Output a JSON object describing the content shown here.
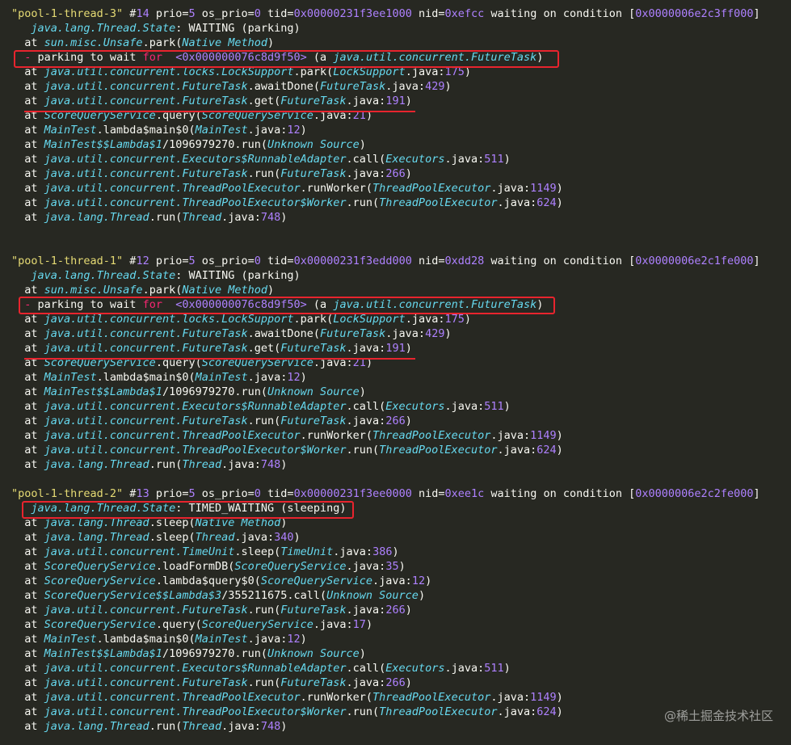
{
  "colors": {
    "background": "#272822",
    "string": "#e6db74",
    "number": "#ae81ff",
    "class": "#66d9ef",
    "plain": "#f8f8f2",
    "keyword": "#f92672",
    "highlight_box": "#e8242e"
  },
  "lines": [
    [
      [
        "s",
        "\"pool-1-thread-3\""
      ],
      [
        "p",
        " #"
      ],
      [
        "n",
        "14"
      ],
      [
        "p",
        " prio="
      ],
      [
        "n",
        "5"
      ],
      [
        "p",
        " os_prio="
      ],
      [
        "n",
        "0"
      ],
      [
        "p",
        " tid="
      ],
      [
        "n",
        "0x00000231f3ee1000"
      ],
      [
        "p",
        " nid="
      ],
      [
        "n",
        "0xefcc"
      ],
      [
        "p",
        " waiting on condition ["
      ],
      [
        "n",
        "0x0000006e2c3ff000"
      ],
      [
        "p",
        "]"
      ]
    ],
    [
      [
        "p",
        "   "
      ],
      [
        "c",
        "java.lang.Thread.State"
      ],
      [
        "p",
        ": WAITING (parking)"
      ]
    ],
    [
      [
        "p",
        "  at "
      ],
      [
        "c",
        "sun.misc.Unsafe"
      ],
      [
        "p",
        ".park("
      ],
      [
        "c",
        "Native Method"
      ],
      [
        "p",
        ")"
      ]
    ],
    [
      [
        "p",
        "  "
      ],
      [
        "k",
        "- "
      ],
      [
        "p",
        "parking to wait "
      ],
      [
        "k",
        "for"
      ],
      [
        "p",
        "  "
      ],
      [
        "n",
        "<0x000000076c8d9f50>"
      ],
      [
        "p",
        " (a "
      ],
      [
        "c",
        "java.util.concurrent.FutureTask"
      ],
      [
        "p",
        ")"
      ]
    ],
    [
      [
        "p",
        "  at "
      ],
      [
        "c",
        "java.util.concurrent.locks.LockSupport"
      ],
      [
        "p",
        ".park("
      ],
      [
        "c",
        "LockSupport"
      ],
      [
        "p",
        ".java:"
      ],
      [
        "n",
        "175"
      ],
      [
        "p",
        ")"
      ]
    ],
    [
      [
        "p",
        "  at "
      ],
      [
        "c",
        "java.util.concurrent.FutureTask"
      ],
      [
        "p",
        ".awaitDone("
      ],
      [
        "c",
        "FutureTask"
      ],
      [
        "p",
        ".java:"
      ],
      [
        "n",
        "429"
      ],
      [
        "p",
        ")"
      ]
    ],
    [
      [
        "p",
        "  at "
      ],
      [
        "c",
        "java.util.concurrent.FutureTask"
      ],
      [
        "p",
        ".get("
      ],
      [
        "c",
        "FutureTask"
      ],
      [
        "p",
        ".java:"
      ],
      [
        "n",
        "191"
      ],
      [
        "p",
        ")"
      ]
    ],
    [
      [
        "p",
        "  at "
      ],
      [
        "c",
        "ScoreQueryService"
      ],
      [
        "p",
        ".query("
      ],
      [
        "c",
        "ScoreQueryService"
      ],
      [
        "p",
        ".java:"
      ],
      [
        "n",
        "21"
      ],
      [
        "p",
        ")"
      ]
    ],
    [
      [
        "p",
        "  at "
      ],
      [
        "c",
        "MainTest"
      ],
      [
        "p",
        ".lambda$main$0("
      ],
      [
        "c",
        "MainTest"
      ],
      [
        "p",
        ".java:"
      ],
      [
        "n",
        "12"
      ],
      [
        "p",
        ")"
      ]
    ],
    [
      [
        "p",
        "  at "
      ],
      [
        "c",
        "MainTest$$Lambda$1"
      ],
      [
        "p",
        "/1096979270.run("
      ],
      [
        "c",
        "Unknown Source"
      ],
      [
        "p",
        ")"
      ]
    ],
    [
      [
        "p",
        "  at "
      ],
      [
        "c",
        "java.util.concurrent.Executors$RunnableAdapter"
      ],
      [
        "p",
        ".call("
      ],
      [
        "c",
        "Executors"
      ],
      [
        "p",
        ".java:"
      ],
      [
        "n",
        "511"
      ],
      [
        "p",
        ")"
      ]
    ],
    [
      [
        "p",
        "  at "
      ],
      [
        "c",
        "java.util.concurrent.FutureTask"
      ],
      [
        "p",
        ".run("
      ],
      [
        "c",
        "FutureTask"
      ],
      [
        "p",
        ".java:"
      ],
      [
        "n",
        "266"
      ],
      [
        "p",
        ")"
      ]
    ],
    [
      [
        "p",
        "  at "
      ],
      [
        "c",
        "java.util.concurrent.ThreadPoolExecutor"
      ],
      [
        "p",
        ".runWorker("
      ],
      [
        "c",
        "ThreadPoolExecutor"
      ],
      [
        "p",
        ".java:"
      ],
      [
        "n",
        "1149"
      ],
      [
        "p",
        ")"
      ]
    ],
    [
      [
        "p",
        "  at "
      ],
      [
        "c",
        "java.util.concurrent.ThreadPoolExecutor$Worker"
      ],
      [
        "p",
        ".run("
      ],
      [
        "c",
        "ThreadPoolExecutor"
      ],
      [
        "p",
        ".java:"
      ],
      [
        "n",
        "624"
      ],
      [
        "p",
        ")"
      ]
    ],
    [
      [
        "p",
        "  at "
      ],
      [
        "c",
        "java.lang.Thread"
      ],
      [
        "p",
        ".run("
      ],
      [
        "c",
        "Thread"
      ],
      [
        "p",
        ".java:"
      ],
      [
        "n",
        "748"
      ],
      [
        "p",
        ")"
      ]
    ],
    [],
    [],
    [
      [
        "s",
        "\"pool-1-thread-1\""
      ],
      [
        "p",
        " #"
      ],
      [
        "n",
        "12"
      ],
      [
        "p",
        " prio="
      ],
      [
        "n",
        "5"
      ],
      [
        "p",
        " os_prio="
      ],
      [
        "n",
        "0"
      ],
      [
        "p",
        " tid="
      ],
      [
        "n",
        "0x00000231f3edd000"
      ],
      [
        "p",
        " nid="
      ],
      [
        "n",
        "0xdd28"
      ],
      [
        "p",
        " waiting on condition ["
      ],
      [
        "n",
        "0x0000006e2c1fe000"
      ],
      [
        "p",
        "]"
      ]
    ],
    [
      [
        "p",
        "   "
      ],
      [
        "c",
        "java.lang.Thread.State"
      ],
      [
        "p",
        ": WAITING (parking)"
      ]
    ],
    [
      [
        "p",
        "  at "
      ],
      [
        "c",
        "sun.misc.Unsafe"
      ],
      [
        "p",
        ".park("
      ],
      [
        "c",
        "Native Method"
      ],
      [
        "p",
        ")"
      ]
    ],
    [
      [
        "p",
        "  "
      ],
      [
        "k",
        "- "
      ],
      [
        "p",
        "parking to wait "
      ],
      [
        "k",
        "for"
      ],
      [
        "p",
        "  "
      ],
      [
        "n",
        "<0x000000076c8d9f50>"
      ],
      [
        "p",
        " (a "
      ],
      [
        "c",
        "java.util.concurrent.FutureTask"
      ],
      [
        "p",
        ")"
      ]
    ],
    [
      [
        "p",
        "  at "
      ],
      [
        "c",
        "java.util.concurrent.locks.LockSupport"
      ],
      [
        "p",
        ".park("
      ],
      [
        "c",
        "LockSupport"
      ],
      [
        "p",
        ".java:"
      ],
      [
        "n",
        "175"
      ],
      [
        "p",
        ")"
      ]
    ],
    [
      [
        "p",
        "  at "
      ],
      [
        "c",
        "java.util.concurrent.FutureTask"
      ],
      [
        "p",
        ".awaitDone("
      ],
      [
        "c",
        "FutureTask"
      ],
      [
        "p",
        ".java:"
      ],
      [
        "n",
        "429"
      ],
      [
        "p",
        ")"
      ]
    ],
    [
      [
        "p",
        "  at "
      ],
      [
        "c",
        "java.util.concurrent.FutureTask"
      ],
      [
        "p",
        ".get("
      ],
      [
        "c",
        "FutureTask"
      ],
      [
        "p",
        ".java:"
      ],
      [
        "n",
        "191"
      ],
      [
        "p",
        ")"
      ]
    ],
    [
      [
        "p",
        "  at "
      ],
      [
        "c",
        "ScoreQueryService"
      ],
      [
        "p",
        ".query("
      ],
      [
        "c",
        "ScoreQueryService"
      ],
      [
        "p",
        ".java:"
      ],
      [
        "n",
        "21"
      ],
      [
        "p",
        ")"
      ]
    ],
    [
      [
        "p",
        "  at "
      ],
      [
        "c",
        "MainTest"
      ],
      [
        "p",
        ".lambda$main$0("
      ],
      [
        "c",
        "MainTest"
      ],
      [
        "p",
        ".java:"
      ],
      [
        "n",
        "12"
      ],
      [
        "p",
        ")"
      ]
    ],
    [
      [
        "p",
        "  at "
      ],
      [
        "c",
        "MainTest$$Lambda$1"
      ],
      [
        "p",
        "/1096979270.run("
      ],
      [
        "c",
        "Unknown Source"
      ],
      [
        "p",
        ")"
      ]
    ],
    [
      [
        "p",
        "  at "
      ],
      [
        "c",
        "java.util.concurrent.Executors$RunnableAdapter"
      ],
      [
        "p",
        ".call("
      ],
      [
        "c",
        "Executors"
      ],
      [
        "p",
        ".java:"
      ],
      [
        "n",
        "511"
      ],
      [
        "p",
        ")"
      ]
    ],
    [
      [
        "p",
        "  at "
      ],
      [
        "c",
        "java.util.concurrent.FutureTask"
      ],
      [
        "p",
        ".run("
      ],
      [
        "c",
        "FutureTask"
      ],
      [
        "p",
        ".java:"
      ],
      [
        "n",
        "266"
      ],
      [
        "p",
        ")"
      ]
    ],
    [
      [
        "p",
        "  at "
      ],
      [
        "c",
        "java.util.concurrent.ThreadPoolExecutor"
      ],
      [
        "p",
        ".runWorker("
      ],
      [
        "c",
        "ThreadPoolExecutor"
      ],
      [
        "p",
        ".java:"
      ],
      [
        "n",
        "1149"
      ],
      [
        "p",
        ")"
      ]
    ],
    [
      [
        "p",
        "  at "
      ],
      [
        "c",
        "java.util.concurrent.ThreadPoolExecutor$Worker"
      ],
      [
        "p",
        ".run("
      ],
      [
        "c",
        "ThreadPoolExecutor"
      ],
      [
        "p",
        ".java:"
      ],
      [
        "n",
        "624"
      ],
      [
        "p",
        ")"
      ]
    ],
    [
      [
        "p",
        "  at "
      ],
      [
        "c",
        "java.lang.Thread"
      ],
      [
        "p",
        ".run("
      ],
      [
        "c",
        "Thread"
      ],
      [
        "p",
        ".java:"
      ],
      [
        "n",
        "748"
      ],
      [
        "p",
        ")"
      ]
    ],
    [],
    [
      [
        "s",
        "\"pool-1-thread-2\""
      ],
      [
        "p",
        " #"
      ],
      [
        "n",
        "13"
      ],
      [
        "p",
        " prio="
      ],
      [
        "n",
        "5"
      ],
      [
        "p",
        " os_prio="
      ],
      [
        "n",
        "0"
      ],
      [
        "p",
        " tid="
      ],
      [
        "n",
        "0x00000231f3ee0000"
      ],
      [
        "p",
        " nid="
      ],
      [
        "n",
        "0xee1c"
      ],
      [
        "p",
        " waiting on condition ["
      ],
      [
        "n",
        "0x0000006e2c2fe000"
      ],
      [
        "p",
        "]"
      ]
    ],
    [
      [
        "p",
        "   "
      ],
      [
        "c",
        "java.lang.Thread.State"
      ],
      [
        "p",
        ": TIMED_WAITING (sleeping)"
      ]
    ],
    [
      [
        "p",
        "  at "
      ],
      [
        "c",
        "java.lang.Thread"
      ],
      [
        "p",
        ".sleep("
      ],
      [
        "c",
        "Native Method"
      ],
      [
        "p",
        ")"
      ]
    ],
    [
      [
        "p",
        "  at "
      ],
      [
        "c",
        "java.lang.Thread"
      ],
      [
        "p",
        ".sleep("
      ],
      [
        "c",
        "Thread"
      ],
      [
        "p",
        ".java:"
      ],
      [
        "n",
        "340"
      ],
      [
        "p",
        ")"
      ]
    ],
    [
      [
        "p",
        "  at "
      ],
      [
        "c",
        "java.util.concurrent.TimeUnit"
      ],
      [
        "p",
        ".sleep("
      ],
      [
        "c",
        "TimeUnit"
      ],
      [
        "p",
        ".java:"
      ],
      [
        "n",
        "386"
      ],
      [
        "p",
        ")"
      ]
    ],
    [
      [
        "p",
        "  at "
      ],
      [
        "c",
        "ScoreQueryService"
      ],
      [
        "p",
        ".loadFormDB("
      ],
      [
        "c",
        "ScoreQueryService"
      ],
      [
        "p",
        ".java:"
      ],
      [
        "n",
        "35"
      ],
      [
        "p",
        ")"
      ]
    ],
    [
      [
        "p",
        "  at "
      ],
      [
        "c",
        "ScoreQueryService"
      ],
      [
        "p",
        ".lambda$query$0("
      ],
      [
        "c",
        "ScoreQueryService"
      ],
      [
        "p",
        ".java:"
      ],
      [
        "n",
        "12"
      ],
      [
        "p",
        ")"
      ]
    ],
    [
      [
        "p",
        "  at "
      ],
      [
        "c",
        "ScoreQueryService$$Lambda$3"
      ],
      [
        "p",
        "/355211675.call("
      ],
      [
        "c",
        "Unknown Source"
      ],
      [
        "p",
        ")"
      ]
    ],
    [
      [
        "p",
        "  at "
      ],
      [
        "c",
        "java.util.concurrent.FutureTask"
      ],
      [
        "p",
        ".run("
      ],
      [
        "c",
        "FutureTask"
      ],
      [
        "p",
        ".java:"
      ],
      [
        "n",
        "266"
      ],
      [
        "p",
        ")"
      ]
    ],
    [
      [
        "p",
        "  at "
      ],
      [
        "c",
        "ScoreQueryService"
      ],
      [
        "p",
        ".query("
      ],
      [
        "c",
        "ScoreQueryService"
      ],
      [
        "p",
        ".java:"
      ],
      [
        "n",
        "17"
      ],
      [
        "p",
        ")"
      ]
    ],
    [
      [
        "p",
        "  at "
      ],
      [
        "c",
        "MainTest"
      ],
      [
        "p",
        ".lambda$main$0("
      ],
      [
        "c",
        "MainTest"
      ],
      [
        "p",
        ".java:"
      ],
      [
        "n",
        "12"
      ],
      [
        "p",
        ")"
      ]
    ],
    [
      [
        "p",
        "  at "
      ],
      [
        "c",
        "MainTest$$Lambda$1"
      ],
      [
        "p",
        "/1096979270.run("
      ],
      [
        "c",
        "Unknown Source"
      ],
      [
        "p",
        ")"
      ]
    ],
    [
      [
        "p",
        "  at "
      ],
      [
        "c",
        "java.util.concurrent.Executors$RunnableAdapter"
      ],
      [
        "p",
        ".call("
      ],
      [
        "c",
        "Executors"
      ],
      [
        "p",
        ".java:"
      ],
      [
        "n",
        "511"
      ],
      [
        "p",
        ")"
      ]
    ],
    [
      [
        "p",
        "  at "
      ],
      [
        "c",
        "java.util.concurrent.FutureTask"
      ],
      [
        "p",
        ".run("
      ],
      [
        "c",
        "FutureTask"
      ],
      [
        "p",
        ".java:"
      ],
      [
        "n",
        "266"
      ],
      [
        "p",
        ")"
      ]
    ],
    [
      [
        "p",
        "  at "
      ],
      [
        "c",
        "java.util.concurrent.ThreadPoolExecutor"
      ],
      [
        "p",
        ".runWorker("
      ],
      [
        "c",
        "ThreadPoolExecutor"
      ],
      [
        "p",
        ".java:"
      ],
      [
        "n",
        "1149"
      ],
      [
        "p",
        ")"
      ]
    ],
    [
      [
        "p",
        "  at "
      ],
      [
        "c",
        "java.util.concurrent.ThreadPoolExecutor$Worker"
      ],
      [
        "p",
        ".run("
      ],
      [
        "c",
        "ThreadPoolExecutor"
      ],
      [
        "p",
        ".java:"
      ],
      [
        "n",
        "624"
      ],
      [
        "p",
        ")"
      ]
    ],
    [
      [
        "p",
        "  at "
      ],
      [
        "c",
        "java.lang.Thread"
      ],
      [
        "p",
        ".run("
      ],
      [
        "c",
        "Thread"
      ],
      [
        "p",
        ".java:"
      ],
      [
        "n",
        "748"
      ],
      [
        "p",
        ")"
      ]
    ]
  ],
  "watermark": "@稀土掘金技术社区"
}
